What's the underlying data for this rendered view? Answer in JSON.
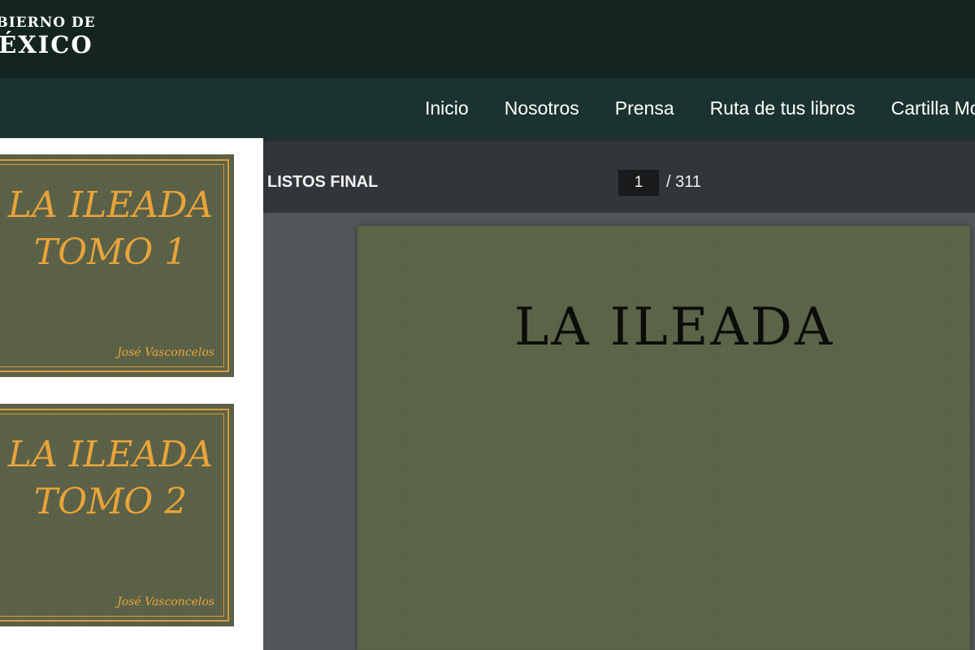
{
  "header": {
    "logo_line1": "GOBIERNO DE",
    "logo_line2": "MÉXICO"
  },
  "nav": {
    "items": [
      {
        "label": "Inicio"
      },
      {
        "label": "Nosotros"
      },
      {
        "label": "Prensa"
      },
      {
        "label": "Ruta de tus libros"
      },
      {
        "label": "Cartilla Moral"
      }
    ]
  },
  "sidebar": {
    "books": [
      {
        "title_line1": "LA ILEADA",
        "title_line2": "TOMO 1",
        "author": "José Vasconcelos"
      },
      {
        "title_line1": "LA ILEADA",
        "title_line2": "TOMO 2",
        "author": "José Vasconcelos"
      }
    ]
  },
  "viewer": {
    "doc_title": "LISTOS FINAL",
    "current_page": "1",
    "page_total": "/ 311",
    "page_title": "LA ILEADA"
  },
  "colors": {
    "brand_dark": "#132421",
    "nav_green": "#1b332e",
    "cover_gold": "#e8a33a",
    "cover_green": "#5a6146",
    "viewer_toolbar": "#323639",
    "viewer_bg": "#525659"
  }
}
